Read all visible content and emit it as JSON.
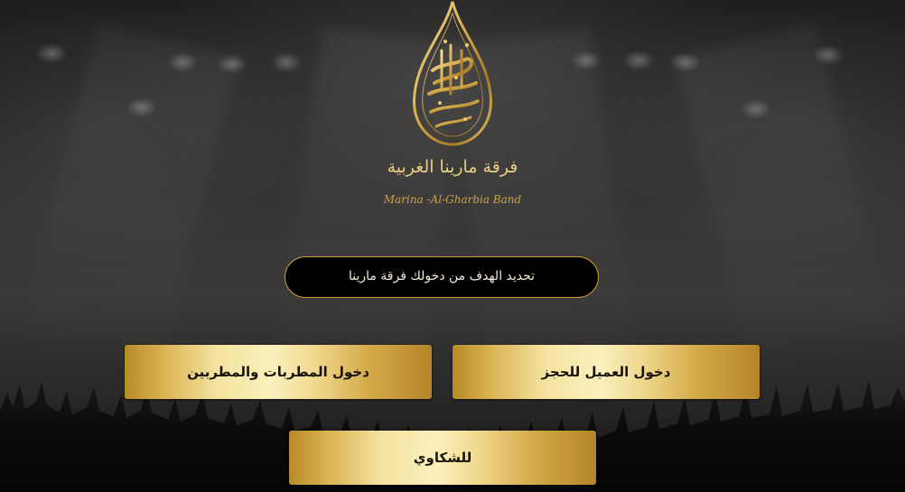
{
  "brand": {
    "title": "فرقة مارينا الغربية",
    "subtitle": "Marina -Al-Gharbia Band",
    "logo_icon": "golden-teardrop-calligraphy-logo",
    "logo_text": "مارينا الغربية"
  },
  "goal": {
    "label": "تحديد الهدف من دخولك فرقة مارينا"
  },
  "buttons": {
    "client_login": "دخول العميل للحجز",
    "singers_login": "دخول المطربات والمطربين",
    "complaints": "للشكاوي"
  },
  "colors": {
    "gold": "#d9b150",
    "gold_light": "#fbf0bd",
    "background": "#2b2a29",
    "goal_box_bg": "#000000"
  }
}
